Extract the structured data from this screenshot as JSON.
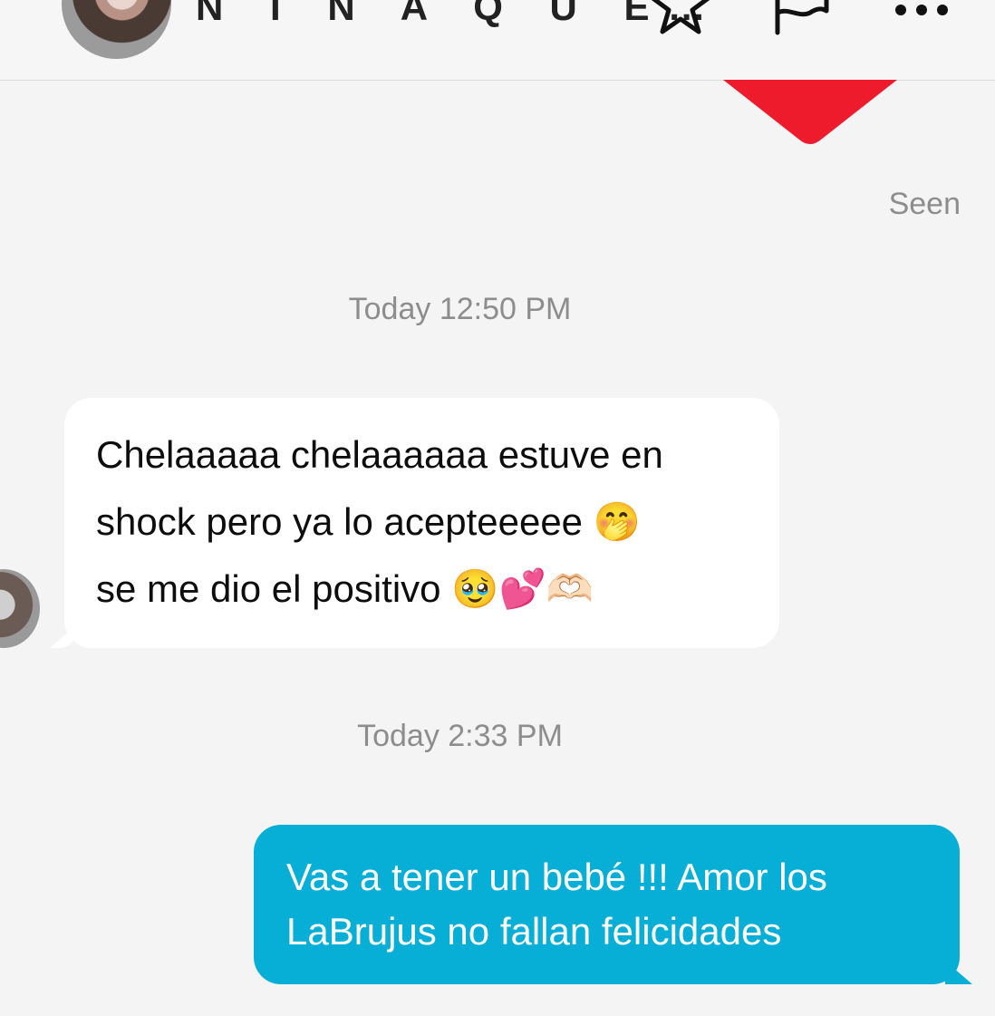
{
  "header": {
    "contact_name": "N I N A Q U E…",
    "icons": [
      "avatar",
      "star-icon",
      "flag-icon",
      "more-icon"
    ]
  },
  "status": {
    "seen": "Seen"
  },
  "conversation": [
    {
      "timestamp": "Today 12:50 PM",
      "direction": "incoming",
      "lines": [
        "Chelaaaaa chelaaaaaa estuve en",
        "shock pero ya lo acepteeeee 🤭",
        "se me dio el positivo 🥹💕🫶🏻"
      ]
    },
    {
      "timestamp": "Today 2:33 PM",
      "direction": "outgoing",
      "lines": [
        "Vas a tener un bebé !!! Amor los",
        "LaBrujus no fallan felicidades"
      ]
    }
  ],
  "colors": {
    "background": "#f4f4f4",
    "incoming_bubble": "#ffffff",
    "outgoing_bubble": "#07aed6",
    "heart": "#ee1b2c",
    "muted_text": "#8d8d8d"
  }
}
